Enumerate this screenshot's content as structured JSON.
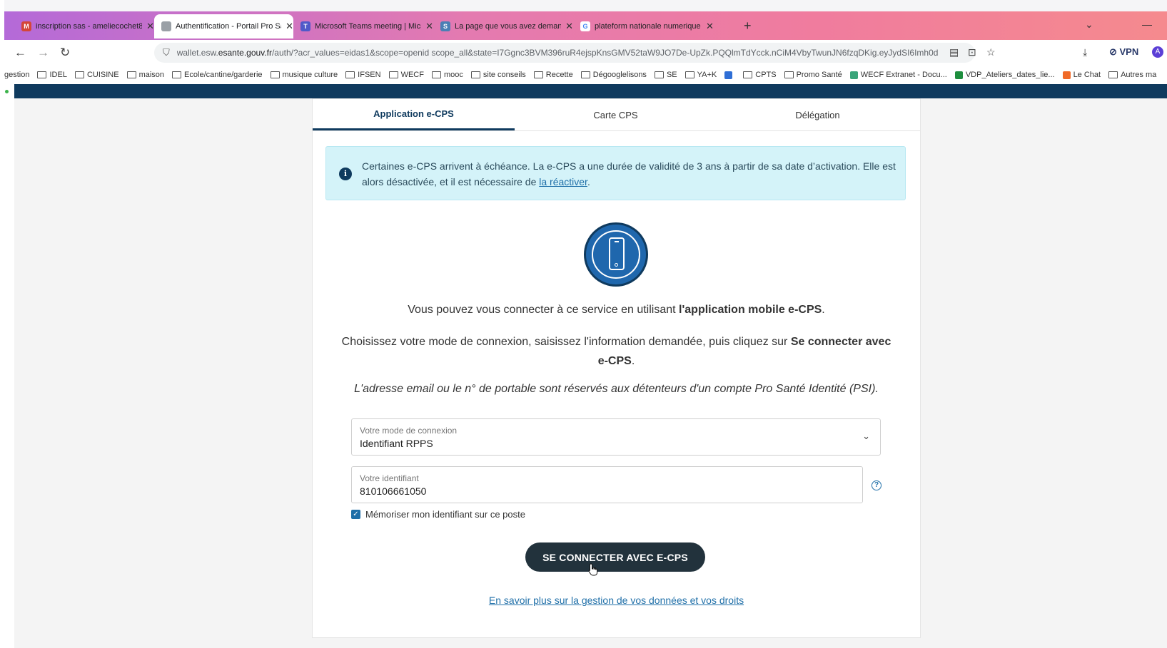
{
  "browser": {
    "tabs": [
      {
        "title": "inscription sas - ameliecochet8",
        "favicon_color": "#d44638",
        "active": false
      },
      {
        "title": "Authentification - Portail Pro Sa",
        "favicon_color": "#9aa0a6",
        "active": true
      },
      {
        "title": "Microsoft Teams meeting | Micr",
        "favicon_color": "#5059c9",
        "active": false
      },
      {
        "title": "La page que vous avez demand",
        "favicon_color": "#4a7fb5",
        "active": false
      },
      {
        "title": "plateform nationale numerique",
        "favicon_color": "#4285f4",
        "active": false
      }
    ],
    "url_prefix": "wallet.esw.",
    "url_domain": "esante.gouv.fr",
    "url_rest": "/auth/?acr_values=eidas1&scope=openid scope_all&state=I7Ggnc3BVM396ruR4ejspKnsGMV52taW9JO7De-UpZk.PQQlmTdYcck.nCiM4VbyTwunJN6fzqDKig.eyJydSI6Imh0d",
    "vpn_label": "VPN",
    "profile_initial": "A",
    "bookmarks": [
      {
        "label": "gestion",
        "kind": "none"
      },
      {
        "label": "IDEL",
        "kind": "folder"
      },
      {
        "label": "CUISINE",
        "kind": "folder"
      },
      {
        "label": "maison",
        "kind": "folder"
      },
      {
        "label": "Ecole/cantine/garderie",
        "kind": "folder"
      },
      {
        "label": "musique culture",
        "kind": "folder"
      },
      {
        "label": "IFSEN",
        "kind": "folder"
      },
      {
        "label": "WECF",
        "kind": "folder"
      },
      {
        "label": "mooc",
        "kind": "folder"
      },
      {
        "label": "site conseils",
        "kind": "folder"
      },
      {
        "label": "Recette",
        "kind": "folder"
      },
      {
        "label": "Dégooglelisons",
        "kind": "folder"
      },
      {
        "label": "SE",
        "kind": "folder"
      },
      {
        "label": "YA+K",
        "kind": "folder"
      },
      {
        "label": "",
        "kind": "app",
        "color": "#2f6fd6"
      },
      {
        "label": "CPTS",
        "kind": "folder"
      },
      {
        "label": "Promo Santé",
        "kind": "folder"
      },
      {
        "label": "WECF Extranet - Docu...",
        "kind": "app",
        "color": "#3aa57a"
      },
      {
        "label": "VDP_Ateliers_dates_lie...",
        "kind": "app",
        "color": "#1e8e3e"
      },
      {
        "label": "Le Chat",
        "kind": "app",
        "color": "#f06a28"
      },
      {
        "label": "Autres ma",
        "kind": "folder"
      }
    ]
  },
  "page": {
    "tabs": [
      {
        "label": "Application e-CPS",
        "active": true
      },
      {
        "label": "Carte CPS",
        "active": false
      },
      {
        "label": "Délégation",
        "active": false
      }
    ],
    "alert": {
      "text": "Certaines e-CPS arrivent à échéance. La e-CPS a une durée de validité de 3 ans à partir de sa date d’activation. Elle est alors désactivée, et il est nécessaire de ",
      "link": "la réactiver",
      "end": "."
    },
    "intro": {
      "before": "Vous pouvez vous connecter à ce service en utilisant ",
      "bold": "l'application mobile e-CPS",
      "after": "."
    },
    "instruction": {
      "before": "Choisissez votre mode de connexion, saisissez l'information demandée, puis cliquez sur ",
      "bold": "Se connecter avec e-CPS",
      "after": "."
    },
    "note": "L'adresse email ou le n° de portable sont réservés aux détenteurs d'un compte Pro Santé Identité (PSI).",
    "mode_field": {
      "label": "Votre mode de connexion",
      "value": "Identifiant RPPS"
    },
    "id_field": {
      "label": "Votre identifiant",
      "value": "810106661050"
    },
    "remember_label": "Mémoriser mon identifiant sur ce poste",
    "remember_checked": true,
    "submit_label": "SE CONNECTER AVEC E-CPS",
    "more_link": "En savoir plus sur la gestion de vos données et vos droits"
  }
}
